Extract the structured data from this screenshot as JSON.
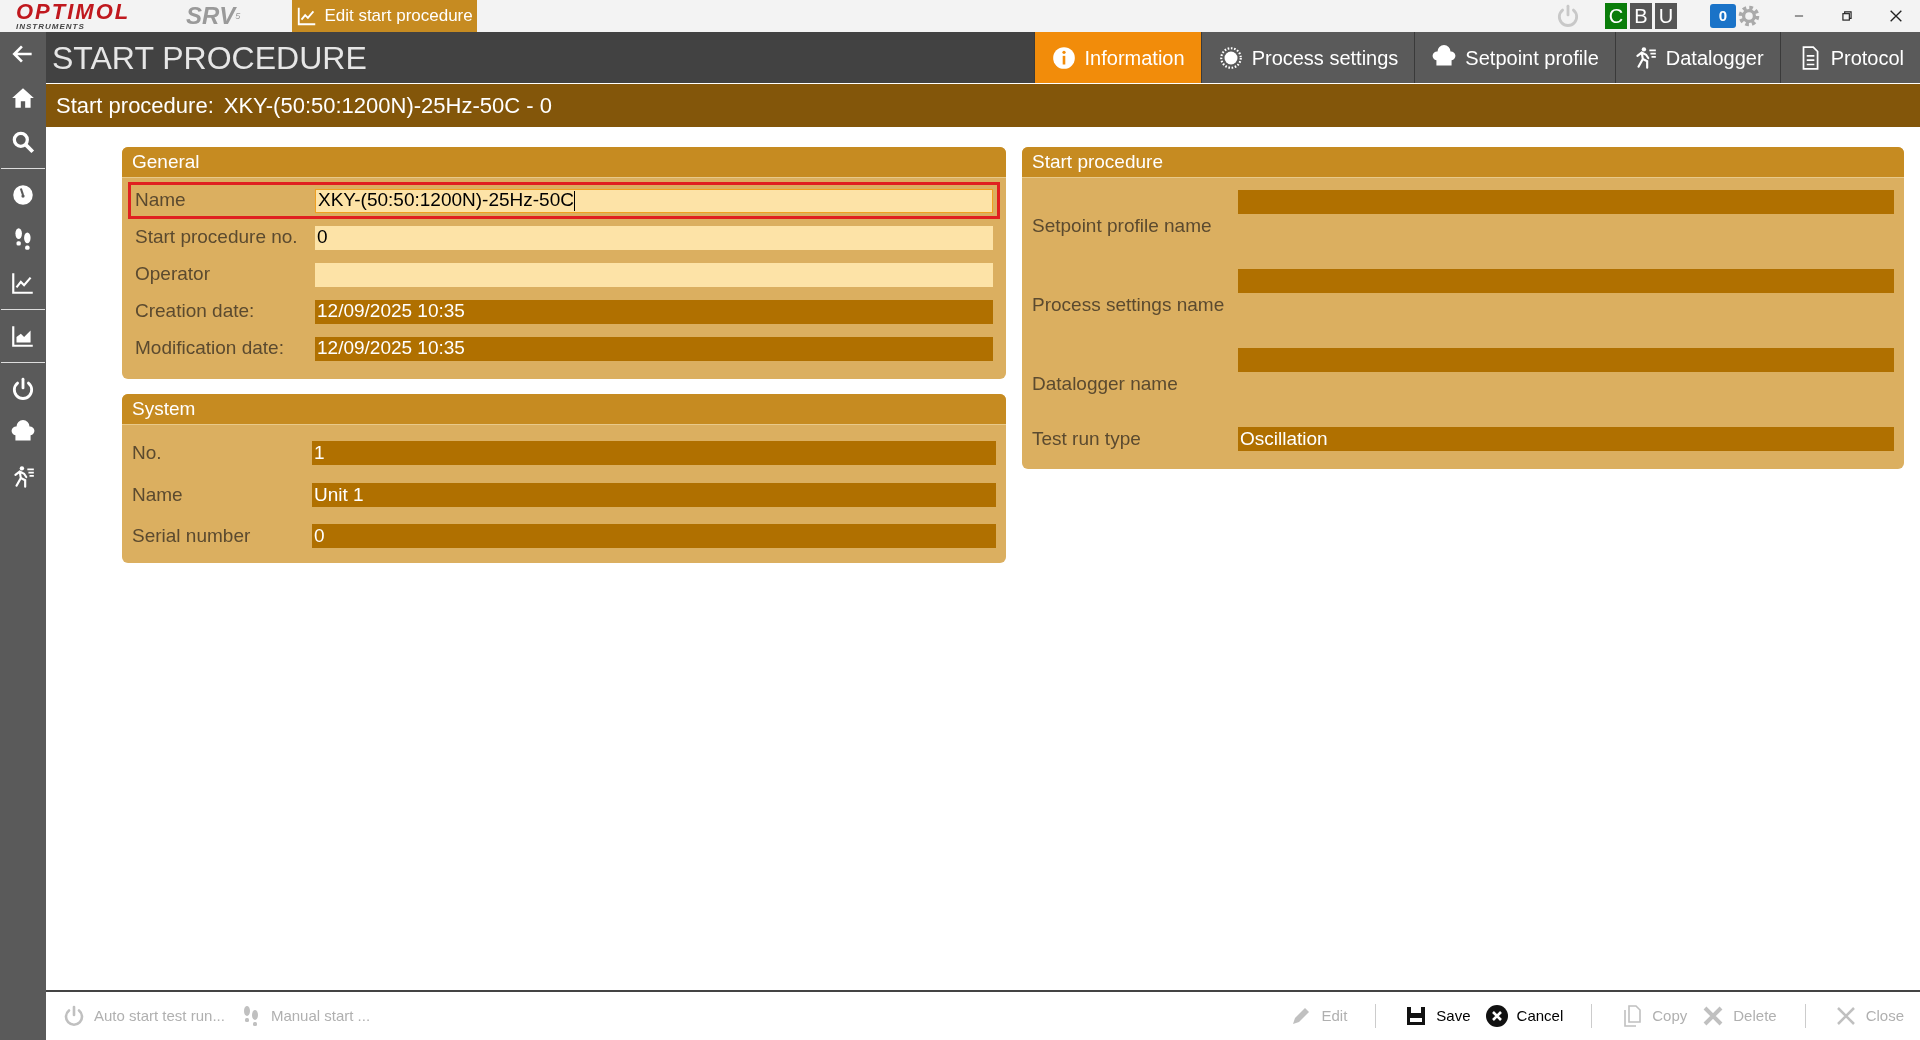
{
  "titlebar": {
    "brand": "OPTIMOL",
    "brand_sub": "INSTRUMENTS",
    "product": "SRV",
    "product_sup": "5",
    "doc_tab": "Edit start procedure",
    "status_letters": [
      {
        "text": "C",
        "color": "#0a7d0a"
      },
      {
        "text": "B",
        "color": "#555555"
      },
      {
        "text": "U",
        "color": "#555555"
      }
    ],
    "message_count": "0"
  },
  "header": {
    "title": "START PROCEDURE",
    "tabs": [
      {
        "label": "Information",
        "selected": true
      },
      {
        "label": "Process settings",
        "selected": false
      },
      {
        "label": "Setpoint profile",
        "selected": false
      },
      {
        "label": "Datalogger",
        "selected": false
      },
      {
        "label": "Protocol",
        "selected": false
      }
    ]
  },
  "subtitle": {
    "label": "Start procedure:",
    "value": "XKY-(50:50:1200N)-25Hz-50C - 0"
  },
  "general": {
    "title": "General",
    "rows": [
      {
        "label": "Name",
        "value": "XKY-(50:50:1200N)-25Hz-50C",
        "editable": true,
        "focused": true
      },
      {
        "label": "Start procedure no.",
        "value": "0",
        "editable": true,
        "focused": false
      },
      {
        "label": "Operator",
        "value": "",
        "editable": true,
        "focused": false
      },
      {
        "label": "Creation date:",
        "value": "12/09/2025 10:35",
        "editable": false,
        "focused": false
      },
      {
        "label": "Modification date:",
        "value": "12/09/2025 10:35",
        "editable": false,
        "focused": false
      }
    ]
  },
  "system": {
    "title": "System",
    "rows": [
      {
        "label": "No.",
        "value": "1",
        "editable": false
      },
      {
        "label": "Name",
        "value": "Unit 1",
        "editable": false
      },
      {
        "label": "Serial number",
        "value": "0",
        "editable": false
      }
    ]
  },
  "start_procedure": {
    "title": "Start procedure",
    "rows": [
      {
        "label": "Setpoint profile name",
        "value": ""
      },
      {
        "label": "Process settings name",
        "value": ""
      },
      {
        "label": "Datalogger name",
        "value": ""
      },
      {
        "label": "Test run type",
        "value": "Oscillation"
      }
    ]
  },
  "toolbar": {
    "left": [
      {
        "label": "Auto start test run...",
        "disabled": true
      },
      {
        "label": "Manual start ...",
        "disabled": true
      }
    ],
    "right_groups": [
      [
        {
          "label": "Edit",
          "disabled": true
        }
      ],
      [
        {
          "label": "Save",
          "disabled": false
        },
        {
          "label": "Cancel",
          "disabled": false
        }
      ],
      [
        {
          "label": "Copy",
          "disabled": true
        },
        {
          "label": "Delete",
          "disabled": true
        }
      ],
      [
        {
          "label": "Close",
          "disabled": true
        }
      ]
    ]
  }
}
